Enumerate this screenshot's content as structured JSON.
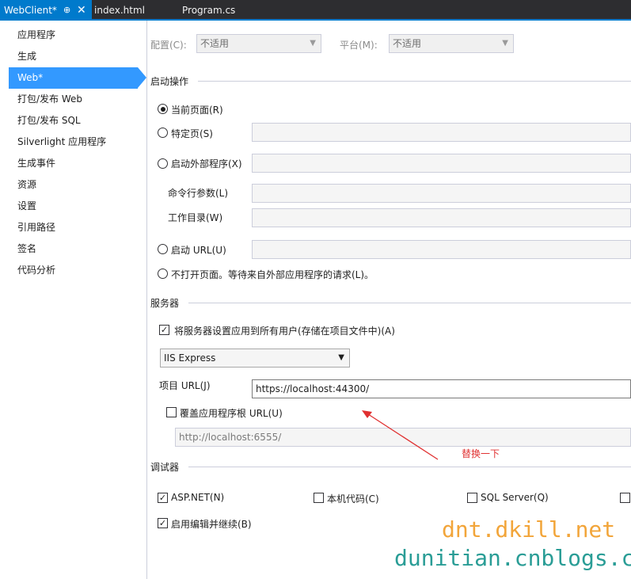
{
  "tabs": [
    {
      "label": "WebClient*",
      "pin": "⊕",
      "close": "✕"
    },
    {
      "label": "index.html"
    },
    {
      "label": "Program.cs"
    }
  ],
  "sidebar": {
    "items": [
      {
        "label": "应用程序"
      },
      {
        "label": "生成"
      },
      {
        "label": "Web*"
      },
      {
        "label": "打包/发布 Web"
      },
      {
        "label": "打包/发布 SQL"
      },
      {
        "label": "Silverlight 应用程序"
      },
      {
        "label": "生成事件"
      },
      {
        "label": "资源"
      },
      {
        "label": "设置"
      },
      {
        "label": "引用路径"
      },
      {
        "label": "签名"
      },
      {
        "label": "代码分析"
      }
    ]
  },
  "config": {
    "configuration_label": "配置(C):",
    "configuration_value": "不适用",
    "platform_label": "平台(M):",
    "platform_value": "不适用"
  },
  "start_action": {
    "title": "启动操作",
    "current_page": "当前页面(R)",
    "specific_page": "特定页(S)",
    "external_program": "启动外部程序(X)",
    "command_args": "命令行参数(L)",
    "working_dir": "工作目录(W)",
    "start_url": "启动 URL(U)",
    "dont_open": "不打开页面。等待来自外部应用程序的请求(L)。"
  },
  "servers": {
    "title": "服务器",
    "apply_all_users": "将服务器设置应用到所有用户(存储在项目文件中)(A)",
    "server_type": "IIS Express",
    "project_url_label": "项目 URL(J)",
    "project_url_value": "https://localhost:44300/",
    "override_root": "覆盖应用程序根 URL(U)",
    "override_url": "http://localhost:6555/"
  },
  "annotation": {
    "text": "替换一下",
    "color": "#e03030"
  },
  "debuggers": {
    "title": "调试器",
    "aspnet": "ASP.NET(N)",
    "native": "本机代码(C)",
    "sql": "SQL Server(Q)",
    "edit_continue": "启用编辑并继续(B)"
  },
  "watermark": {
    "line1": "dnt.dkill.net",
    "line2": "dunitian.cnblogs.com"
  },
  "colors": {
    "accent": "#007acc",
    "selection": "#3399ff",
    "watermark1": "#f2a53a",
    "watermark2": "#2a9d96"
  }
}
